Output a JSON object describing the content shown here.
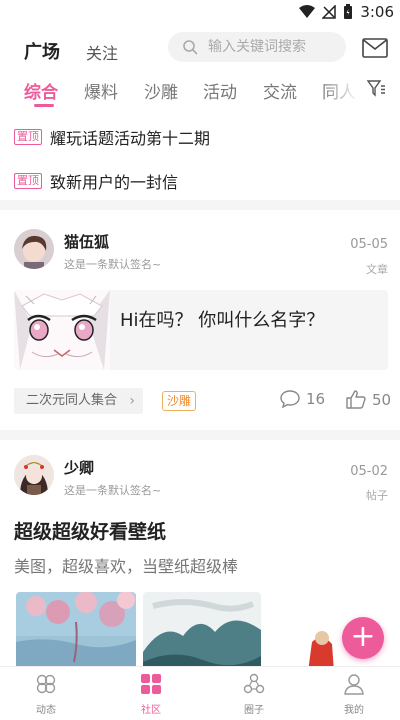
{
  "status_bar": {
    "time": "3:06"
  },
  "header": {
    "tabs": [
      {
        "label": "广场",
        "active": true
      },
      {
        "label": "关注",
        "active": false
      }
    ],
    "search_placeholder": "输入关键词搜索",
    "mail_icon": "envelope-icon"
  },
  "categories": [
    {
      "label": "综合",
      "active": true
    },
    {
      "label": "爆料",
      "active": false
    },
    {
      "label": "沙雕",
      "active": false
    },
    {
      "label": "活动",
      "active": false
    },
    {
      "label": "交流",
      "active": false
    },
    {
      "label": "同人",
      "active": false
    }
  ],
  "pinned": [
    {
      "badge": "置顶",
      "title": "耀玩话题活动第十二期"
    },
    {
      "badge": "置顶",
      "title": "致新用户的一封信"
    }
  ],
  "posts": [
    {
      "user": "猫伍狐",
      "signature": "这是一条默认签名~",
      "date": "05-05",
      "type": "文章",
      "chat_text": "Hi在吗？ 你叫什么名字？",
      "topic": "二次元同人集合",
      "tag": "沙雕",
      "comments": "16",
      "likes": "50"
    },
    {
      "user": "少卿",
      "signature": "这是一条默认签名~",
      "date": "05-02",
      "type": "帖子",
      "title": "超级超级好看壁纸",
      "body": "美图，超级喜欢，当壁纸超级棒"
    }
  ],
  "fab_label": "+",
  "bottom_nav": [
    {
      "label": "动态",
      "icon": "clover-icon",
      "active": false
    },
    {
      "label": "社区",
      "icon": "grid-icon",
      "active": true
    },
    {
      "label": "圈子",
      "icon": "circles-icon",
      "active": false
    },
    {
      "label": "我的",
      "icon": "user-icon",
      "active": false
    }
  ],
  "colors": {
    "accent": "#ee5b9a",
    "tag_orange": "#ee8a2d"
  }
}
